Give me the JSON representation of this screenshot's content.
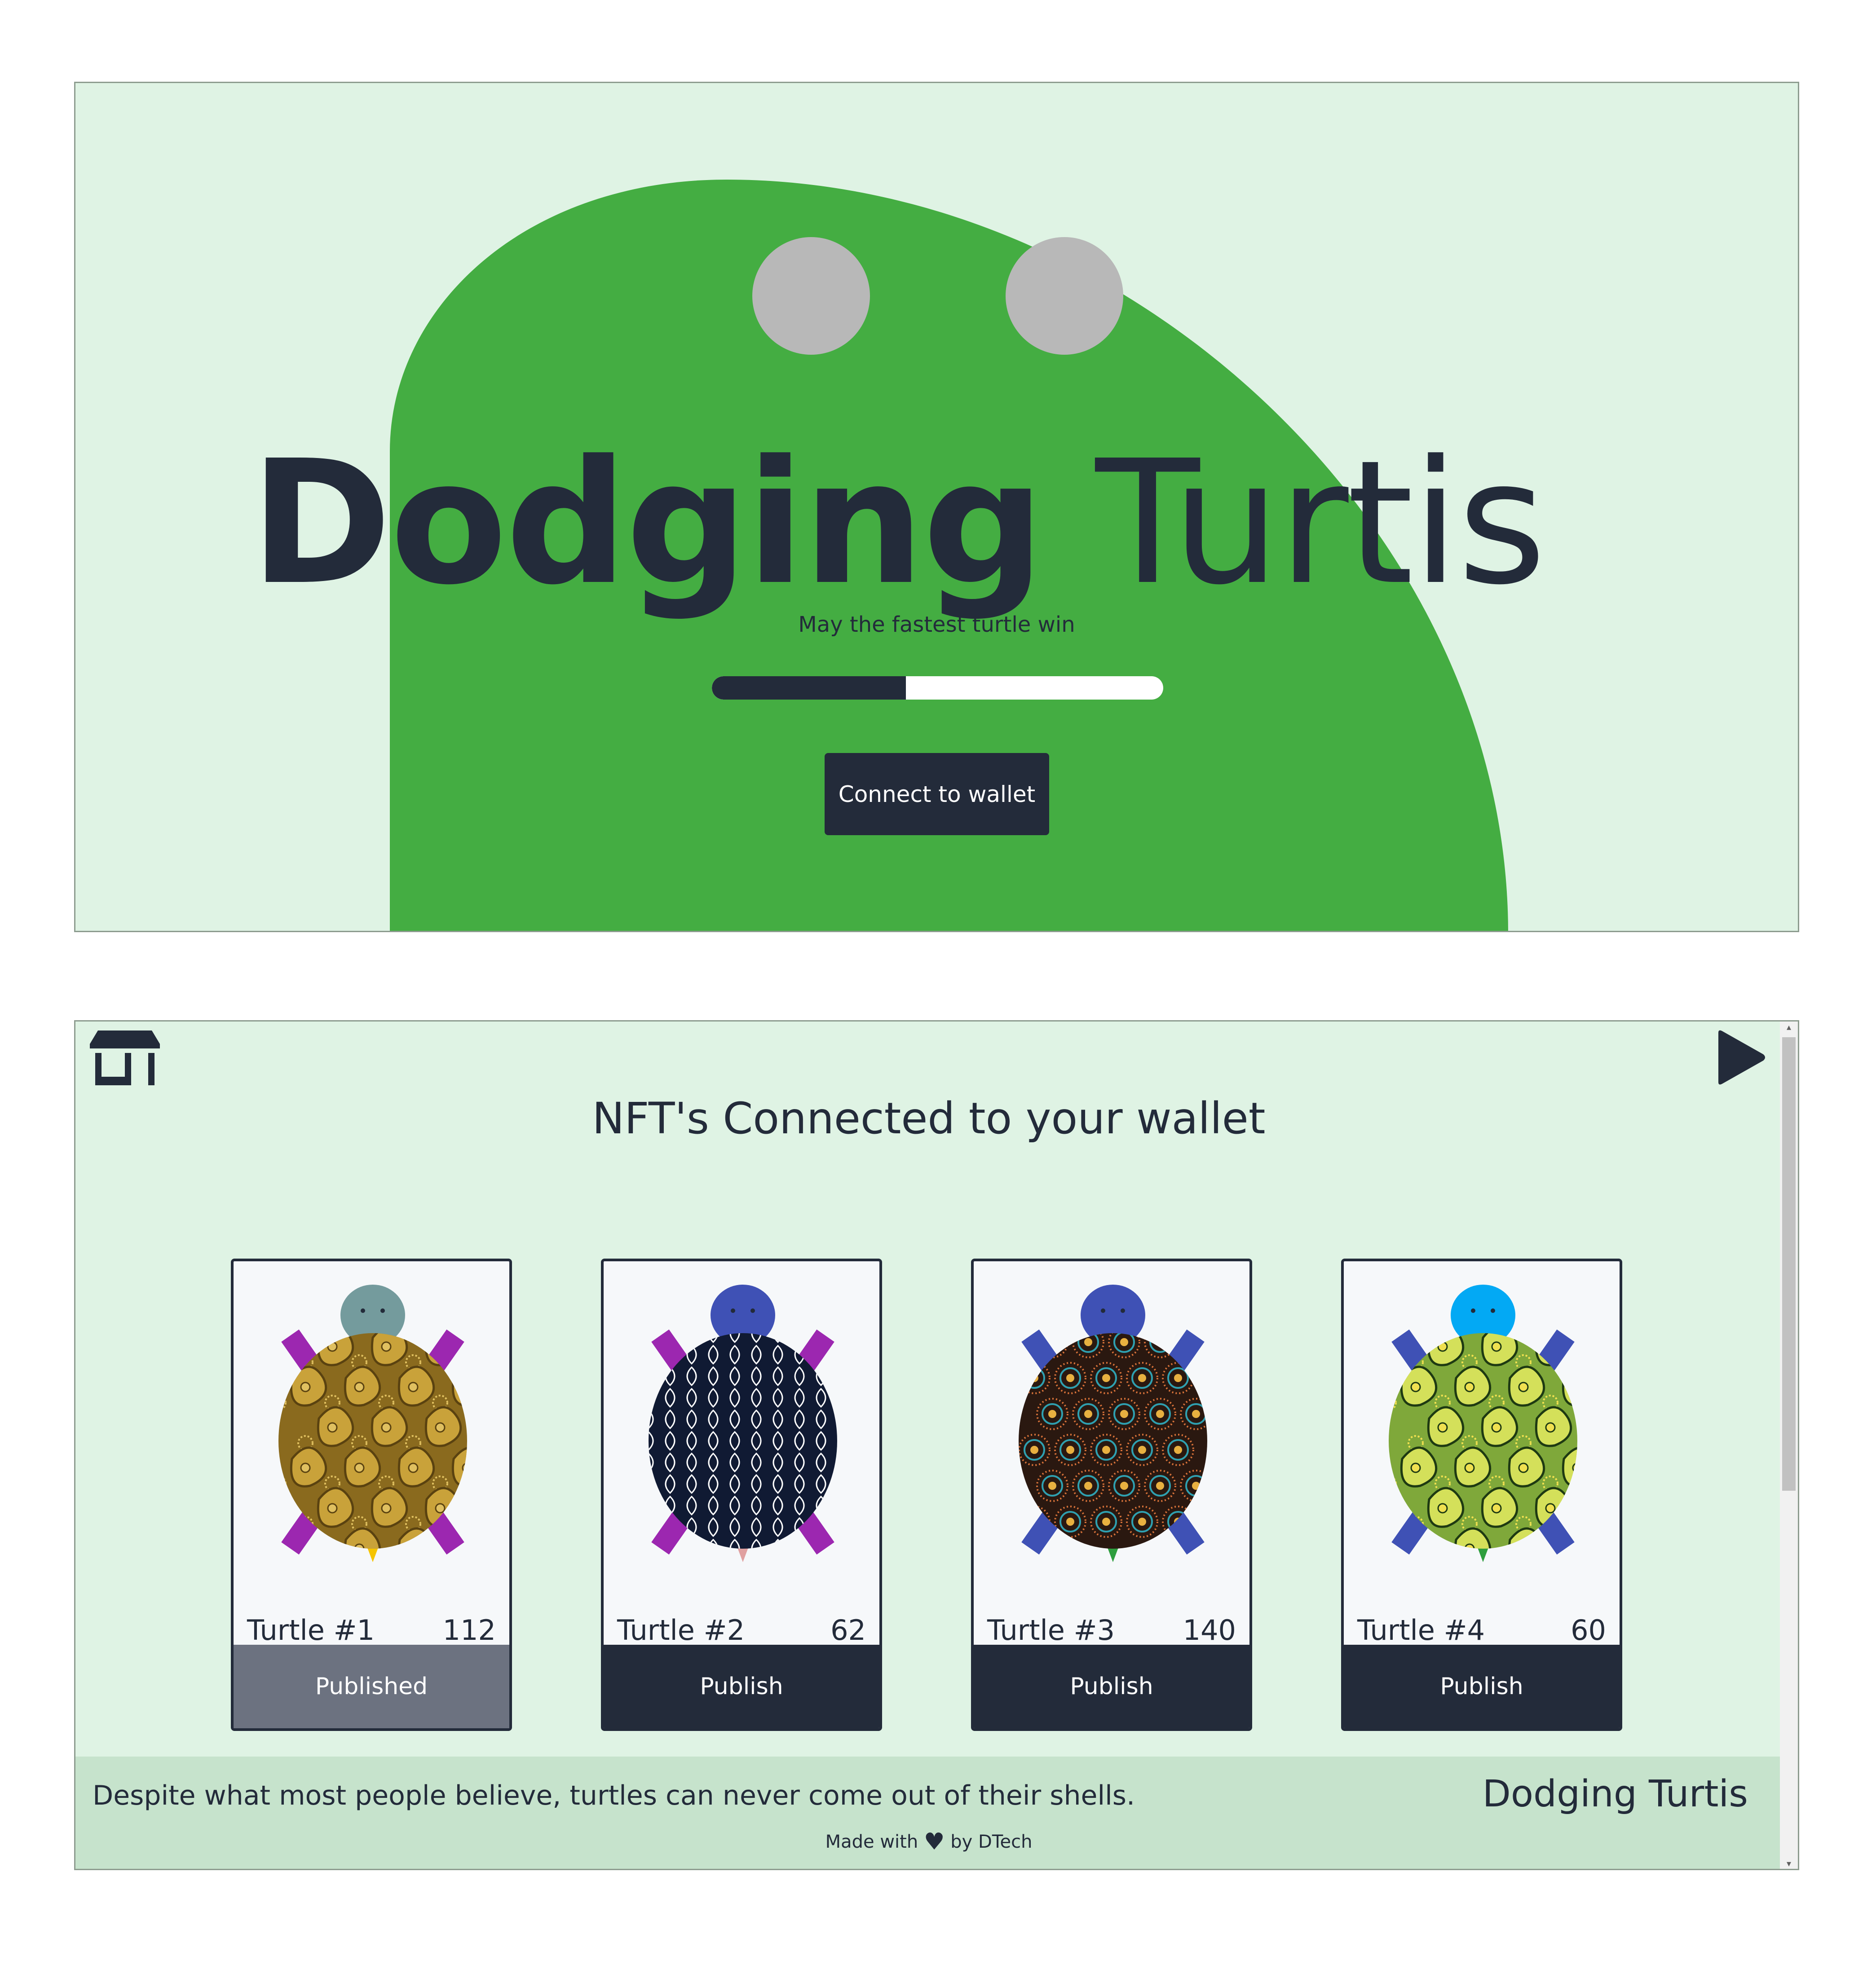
{
  "hero": {
    "title_part1": "Dodging",
    "title_part2": "Turtis",
    "subtitle": "May the fastest turtle win",
    "progress_fraction": 0.43,
    "connect_label": "Connect to wallet",
    "colors": {
      "background": "#dff3e4",
      "blob": "#44ad42",
      "eyes": "#b8b8b8",
      "text": "#232b3a"
    }
  },
  "app": {
    "store_icon": "store-icon",
    "play_icon": "play-icon",
    "heading": "NFT's Connected to your wallet",
    "cards": [
      {
        "name": "Turtle #1",
        "score": "112",
        "button": "Published",
        "published": true,
        "head": "#749b9d",
        "legs": "#9c27b0",
        "tail": "#f5c400",
        "shell": "paisley-gold"
      },
      {
        "name": "Turtle #2",
        "score": "62",
        "button": "Publish",
        "published": false,
        "head": "#3f51b5",
        "legs": "#9c27b0",
        "tail": "#e0a0a0",
        "shell": "lattice-navy"
      },
      {
        "name": "Turtle #3",
        "score": "140",
        "button": "Publish",
        "published": false,
        "head": "#3f51b5",
        "legs": "#3f51b5",
        "tail": "#2e9e3e",
        "shell": "dots-dark"
      },
      {
        "name": "Turtle #4",
        "score": "60",
        "button": "Publish",
        "published": false,
        "head": "#03a9f4",
        "legs": "#3f51b5",
        "tail": "#2e9e3e",
        "shell": "paisley-green"
      }
    ],
    "footer": {
      "fact": "Despite what most people believe, turtles can never come out of their shells.",
      "brand": "Dodging Turtis",
      "made_prefix": "Made with",
      "heart_icon": "heart-icon",
      "made_suffix": "by DTech"
    }
  }
}
